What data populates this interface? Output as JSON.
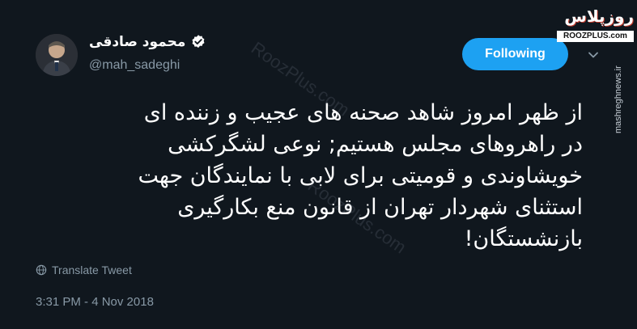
{
  "profile": {
    "display_name": "محمود صادقی",
    "handle": "@mah_sadeghi",
    "verified_icon": "verified-badge-icon",
    "avatar_icon": "avatar"
  },
  "actions": {
    "follow_label": "Following",
    "menu_icon": "chevron-down-icon"
  },
  "tweet": {
    "text": "از ظهر امروز شاهد صحنه های عجیب و زننده ای\nدر راهروهای مجلس هستیم; نوعی لشگرکشی\nخویشاوندی و قومیتی برای لابی با نمایندگان جهت\nاستثنای شهردار تهران از قانون منع بکارگیری\nبازنشستگان!",
    "translate_label": "Translate Tweet",
    "timestamp": "3:31 PM - 4 Nov 2018"
  },
  "watermarks": {
    "logo_text": "روزپلاس",
    "logo_url": "ROOZPLUS.com",
    "side_text": "mashreghnews.ir",
    "diagonal_1": "RoozPlus.com",
    "diagonal_2": "RoozPlus.com"
  },
  "colors": {
    "background": "#10171e",
    "accent": "#1da1f2",
    "muted": "#8899a6"
  }
}
